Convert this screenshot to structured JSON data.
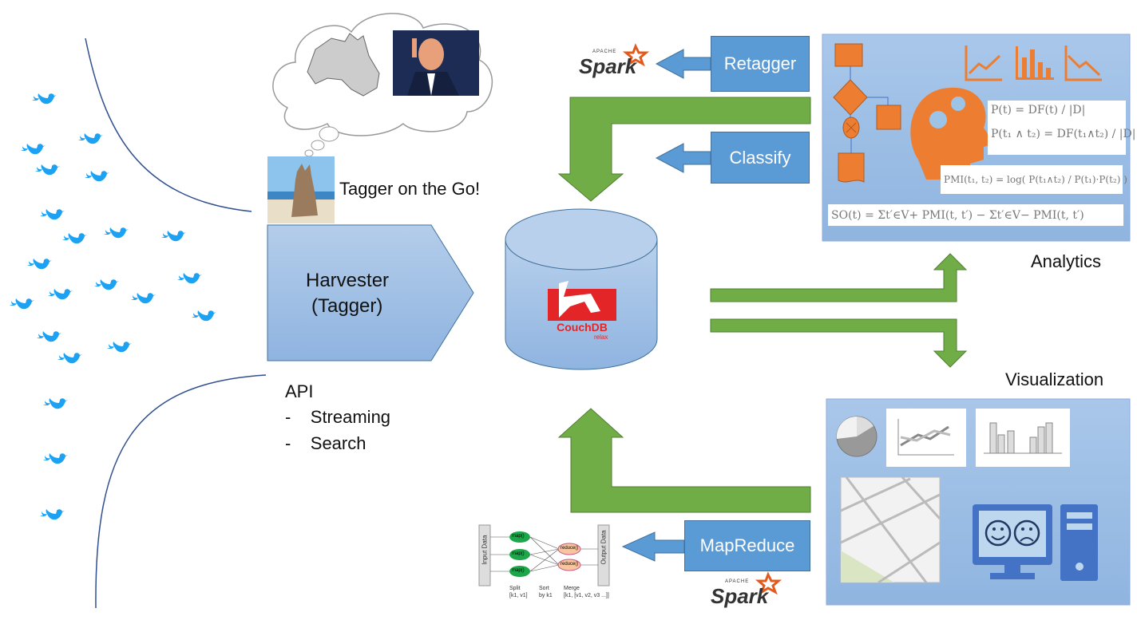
{
  "colors": {
    "twitter": "#1da1f2",
    "box_blue": "#5b9bd5",
    "arrow_green": "#70ad47",
    "panel_blue": "#9dc3e6",
    "orange": "#ed7d31",
    "couch_red": "#e42528"
  },
  "tagger": {
    "caption": "Tagger on the Go!"
  },
  "harvester": {
    "line1": "Harvester",
    "line2": "(Tagger)"
  },
  "api": {
    "title": "API",
    "items": [
      "-    Streaming",
      "-    Search"
    ]
  },
  "database": {
    "name": "CouchDB",
    "tagline": "relax"
  },
  "processes": {
    "retagger": "Retagger",
    "classify": "Classify",
    "mapreduce": "MapReduce"
  },
  "spark": {
    "apache": "APACHE",
    "name": "Spark"
  },
  "analytics": {
    "label": "Analytics",
    "formulas": [
      "P(t) = DF(t) / |D|",
      "P(t₁ ∧ t₂) = DF(t₁∧t₂) / |D|",
      "PMI(t₁, t₂) = log( P(t₁∧t₂) / P(t₁)·P(t₂) )",
      "SO(t) = Σt′∈V+ PMI(t, t′) − Σt′∈V− PMI(t, t′)"
    ]
  },
  "visualization": {
    "label": "Visualization"
  },
  "mapreduce_diagram": {
    "input": "Input Data",
    "output": "Output Data",
    "map": "map()",
    "reduce": "reduce()",
    "split": "Split",
    "split_sub": "[k1, v1]",
    "sort": "Sort",
    "sort_sub": "by k1",
    "merge": "Merge",
    "merge_sub": "[k1, [v1, v2, v3 ...]]"
  },
  "icons": [
    "twitter-bird-icon",
    "australia-map-icon",
    "kangaroo-photo",
    "person-photo",
    "spark-logo",
    "couchdb-logo",
    "flowchart-icon",
    "brain-gears-icon",
    "chart-up-icon",
    "bar-chart-icon",
    "chart-down-icon",
    "pie-chart-icon",
    "line-chart-icon",
    "map-icon",
    "computer-icon"
  ]
}
